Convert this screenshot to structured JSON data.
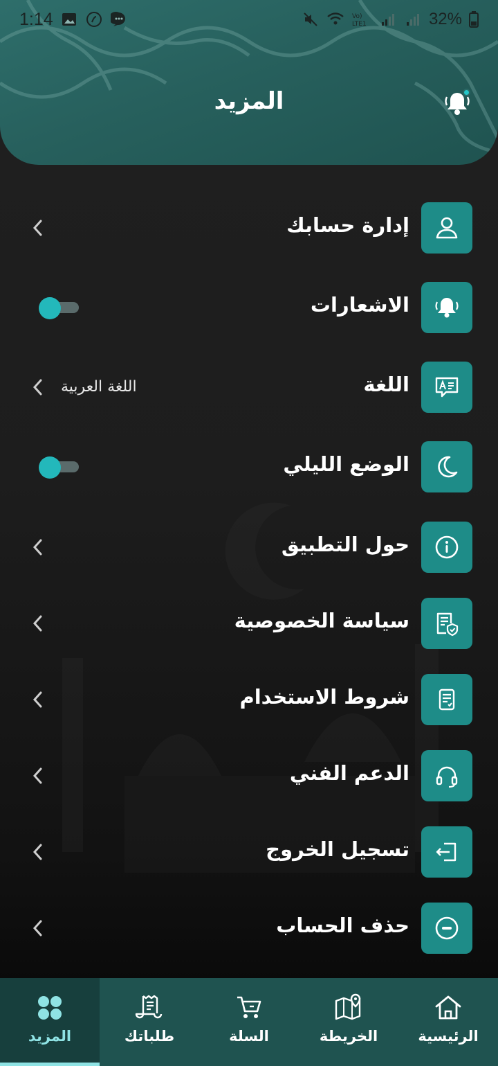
{
  "status_bar": {
    "time": "1:14",
    "battery": "32%",
    "network": "LTE1"
  },
  "header": {
    "title": "المزيد"
  },
  "menu": {
    "items": [
      {
        "label": "إدارة حسابك",
        "icon": "user-icon",
        "control": "chevron"
      },
      {
        "label": "الاشعارات",
        "icon": "bell-icon",
        "control": "toggle",
        "toggle_on": false
      },
      {
        "label": "اللغة",
        "icon": "language-icon",
        "control": "chevron",
        "value": "اللغة العربية"
      },
      {
        "label": "الوضع الليلي",
        "icon": "moon-icon",
        "control": "toggle",
        "toggle_on": false
      },
      {
        "label": "حول التطبيق",
        "icon": "info-icon",
        "control": "chevron"
      },
      {
        "label": "سياسة الخصوصية",
        "icon": "privacy-icon",
        "control": "chevron"
      },
      {
        "label": "شروط الاستخدام",
        "icon": "document-icon",
        "control": "chevron"
      },
      {
        "label": "الدعم الفني",
        "icon": "headset-icon",
        "control": "chevron"
      },
      {
        "label": "تسجيل الخروج",
        "icon": "logout-icon",
        "control": "chevron"
      },
      {
        "label": "حذف الحساب",
        "icon": "minus-circle-icon",
        "control": "chevron"
      }
    ]
  },
  "bottom_nav": {
    "items": [
      {
        "label": "الرئيسية",
        "icon": "home-icon"
      },
      {
        "label": "الخريطة",
        "icon": "map-icon"
      },
      {
        "label": "السلة",
        "icon": "cart-icon"
      },
      {
        "label": "طلباتك",
        "icon": "receipt-icon"
      },
      {
        "label": "المزيد",
        "icon": "grid-icon",
        "active": true
      }
    ]
  },
  "colors": {
    "accent": "#1e8c88",
    "header": "#27605d",
    "nav_bg": "#1f5350",
    "nav_active": "#173f3d",
    "active_label": "#8fe3e4",
    "toggle_knob": "#23b8bb"
  }
}
